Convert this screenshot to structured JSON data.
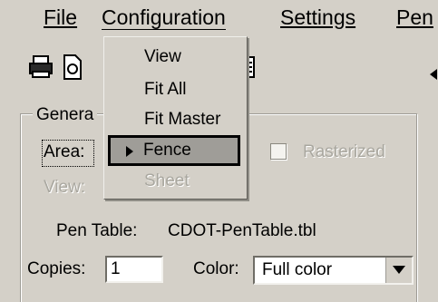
{
  "menubar": {
    "file": "File",
    "configuration": "Configuration",
    "settings": "Settings",
    "pen": "Pen"
  },
  "toolbar": {
    "icons": [
      "printer-icon",
      "preview-icon",
      "printer-setup-icon"
    ]
  },
  "dropdown": {
    "items": [
      {
        "label": "View",
        "enabled": true
      },
      {
        "label": "Fit All",
        "enabled": true
      },
      {
        "label": "Fit Master",
        "enabled": true
      },
      {
        "label": "Fence",
        "enabled": true,
        "selected": true
      },
      {
        "label": "Sheet",
        "enabled": false
      }
    ]
  },
  "general": {
    "legend": "Genera",
    "area_label": "Area:",
    "view_label": "View:",
    "rasterized_label": "Rasterized",
    "rasterized_checked": false,
    "pen_table_label": "Pen Table:",
    "pen_table_value": "CDOT-PenTable.tbl",
    "copies_label": "Copies:",
    "copies_value": "1",
    "color_label": "Color:",
    "color_value": "Full color"
  },
  "colors": {
    "window_bg": "#d4d0c8",
    "selected_item_bg": "#9f9d98",
    "disabled_text": "#a9a79f"
  }
}
